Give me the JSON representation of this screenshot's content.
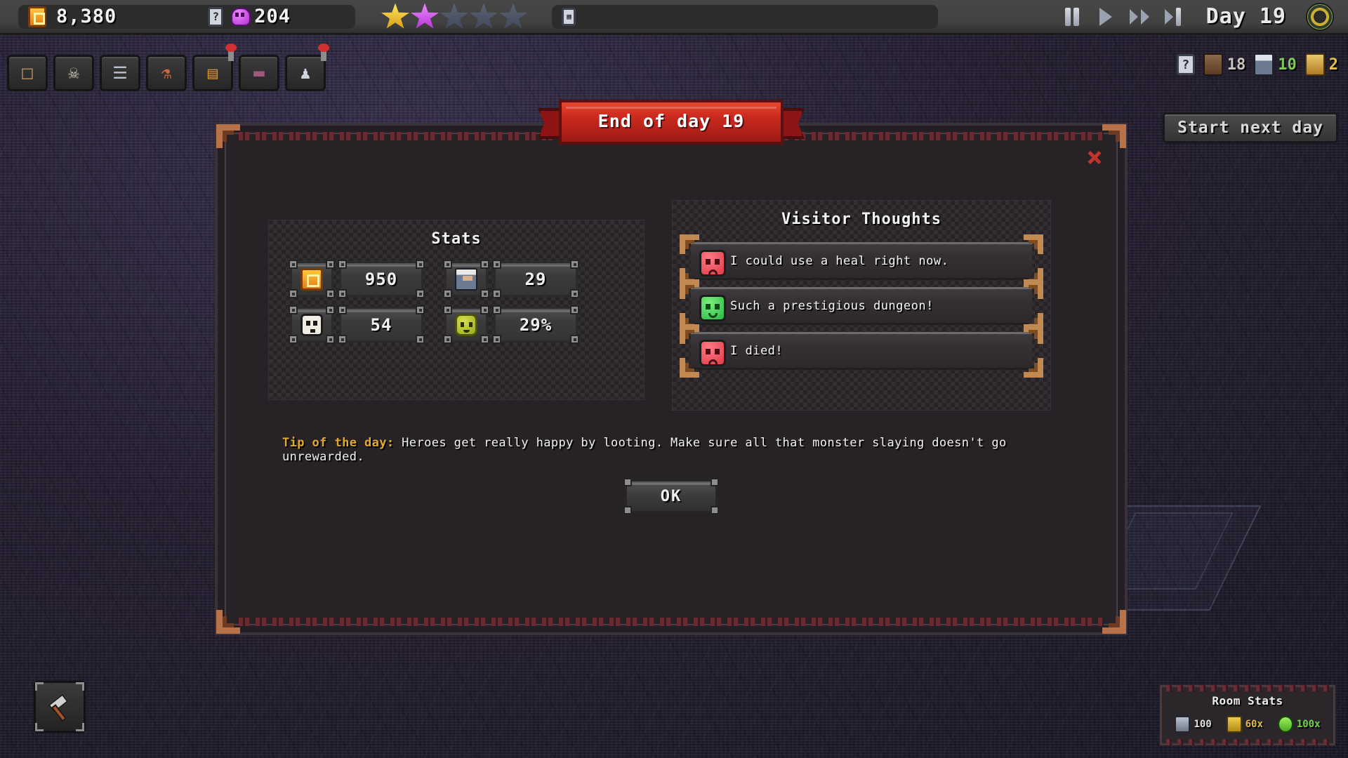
{
  "topbar": {
    "gold_icon": "gold-bar-icon",
    "gold": "8,380",
    "tag_icon": "hint-tag-icon",
    "soul_icon": "soul-ghost-icon",
    "souls": "204",
    "stars_filled": 2,
    "stars_total": 5,
    "star_colors": [
      "#e5bb2a",
      "#cf4fe0",
      "#4a5368",
      "#4a5368",
      "#4a5368"
    ],
    "menu_icon": "grid-menu-icon",
    "pause_icon": "pause-icon",
    "play_icon": "play-icon",
    "fastforward_icon": "fast-forward-icon",
    "step_icon": "step-frame-icon",
    "day_label": "Day 19",
    "settings_icon": "gear-wheel-icon"
  },
  "toolbar": {
    "items": [
      {
        "name": "room-build-icon",
        "glyph": "□"
      },
      {
        "name": "monster-skull-icon",
        "glyph": "☠"
      },
      {
        "name": "research-book-icon",
        "glyph": "☰"
      },
      {
        "name": "potion-shop-icon",
        "glyph": "⚗"
      },
      {
        "name": "treasure-chest-icon",
        "glyph": "▤"
      },
      {
        "name": "trap-icon",
        "glyph": "▬"
      },
      {
        "name": "hero-manage-icon",
        "glyph": "♟"
      }
    ]
  },
  "right_hud": {
    "help_icon": "question-mark-icon",
    "counters": [
      {
        "icon": "monster-icon",
        "value": "18",
        "color": "#c9c4bb"
      },
      {
        "icon": "hero-icon",
        "value": "10",
        "color": "#7dc85a"
      },
      {
        "icon": "visitor-icon",
        "value": "2",
        "color": "#e5c04a"
      }
    ],
    "start_next_day": "Start next day"
  },
  "modal": {
    "banner_title": "End of day 19",
    "close_icon": "close-x-icon",
    "stats": {
      "title": "Stats",
      "rows": [
        {
          "icon": "gold-bar-icon",
          "value": "950",
          "icon2": "hero-icon",
          "value2": "29"
        },
        {
          "icon": "skull-icon",
          "value": "54",
          "icon2": "slime-monster-icon",
          "value2": "29%"
        }
      ]
    },
    "thoughts": {
      "title": "Visitor Thoughts",
      "items": [
        {
          "mood": "sad",
          "mood_icon": "sad-face-icon",
          "text": "I could use a heal right now."
        },
        {
          "mood": "happy",
          "mood_icon": "happy-face-icon",
          "text": "Such a prestigious dungeon!"
        },
        {
          "mood": "sad",
          "mood_icon": "sad-face-icon",
          "text": "I died!"
        }
      ]
    },
    "tip_label": "Tip of the day:",
    "tip_text": "Heroes get really happy by looting. Make sure all that monster slaying doesn't go unrewarded.",
    "ok_label": "OK"
  },
  "bottom_left": {
    "item_icon": "hammer-item-icon"
  },
  "room_stats": {
    "title": "Room Stats",
    "items": [
      {
        "icon": "wood-resource-icon",
        "value": "100",
        "color": "#dedede"
      },
      {
        "icon": "trophy-icon",
        "value": "60x",
        "color": "#e0b93a"
      },
      {
        "icon": "spark-icon",
        "value": "100x",
        "color": "#6fd34a"
      }
    ]
  },
  "colors": {
    "accent_red": "#cc2a1e",
    "accent_gold": "#e2a82c",
    "panel_bg": "#2b272b",
    "modal_bg": "#262226"
  }
}
